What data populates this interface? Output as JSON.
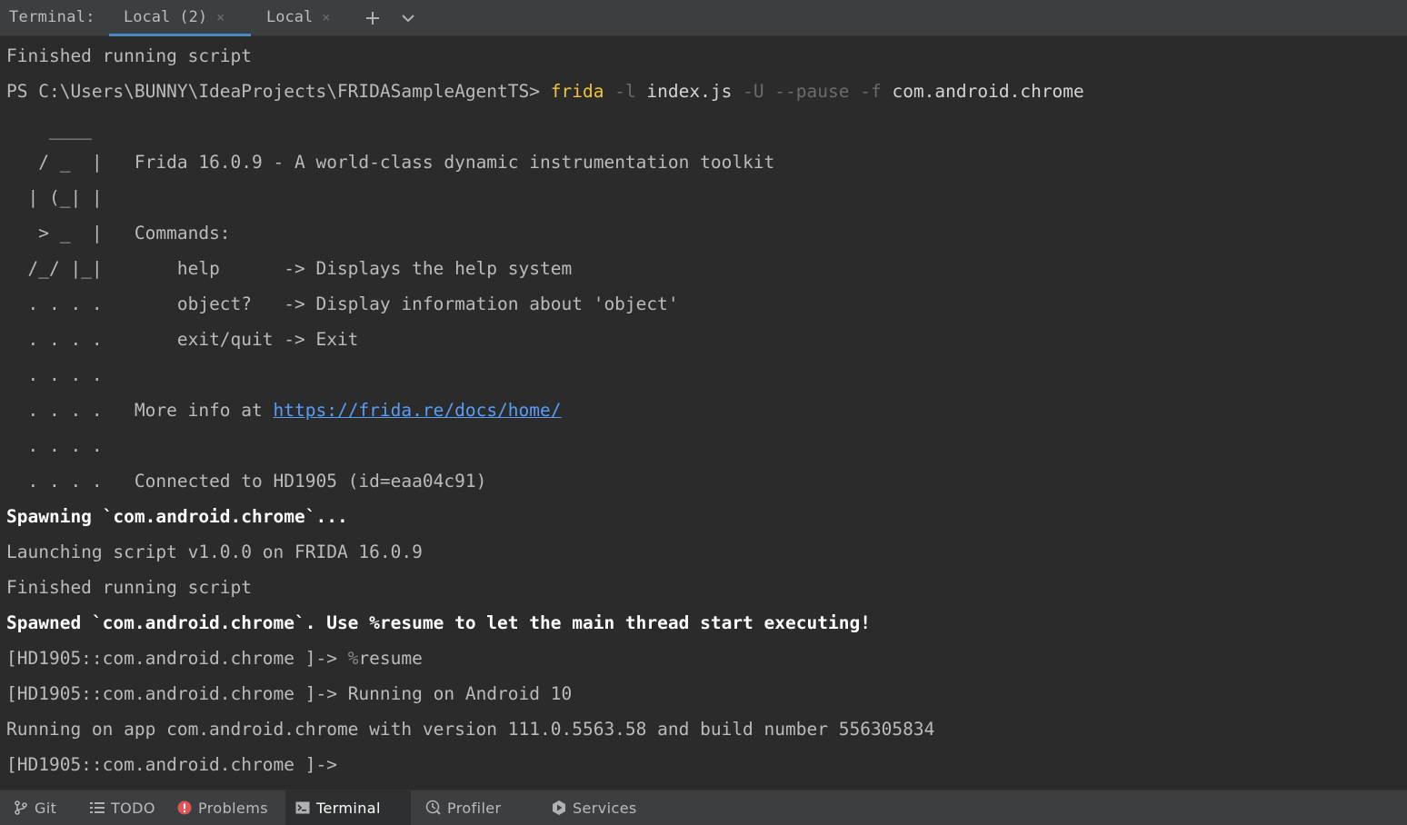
{
  "tabbar": {
    "title": "Terminal:",
    "tabs": [
      {
        "label": "Local (2)",
        "active": true
      },
      {
        "label": "Local",
        "active": false
      }
    ],
    "close_glyph": "×",
    "add_icon": "plus-icon",
    "more_icon": "chevron-down-icon"
  },
  "terminal": {
    "l01": "Finished running script",
    "l02": {
      "prompt": "PS C:\\Users\\BUNNY\\IdeaProjects\\FRIDASampleAgentTS> ",
      "cmd": "frida",
      "opt1": " -l ",
      "arg1": "index.js",
      "opt2": " -U --pause -f ",
      "arg2": "com.android.chrome"
    },
    "l03": "    ____",
    "l04": {
      "art": "   / _  |   ",
      "text": "Frida 16.0.9 - A world-class dynamic instrumentation toolkit"
    },
    "l05": {
      "art": "  | (_| |",
      "text": ""
    },
    "l06": {
      "art": "   > _  |   ",
      "text": "Commands:"
    },
    "l07": {
      "art": "  /_/ |_|       ",
      "text": "help      -> Displays the help system"
    },
    "l08": {
      "art": "  . . . .       ",
      "text": "object?   -> Display information about 'object'"
    },
    "l09": {
      "art": "  . . . .       ",
      "text": "exit/quit -> Exit"
    },
    "l10": {
      "art": "  . . . .",
      "text": ""
    },
    "l11": {
      "art": "  . . . .   ",
      "text": "More info at ",
      "link": "https://frida.re/docs/home/"
    },
    "l12": {
      "art": "  . . . .",
      "text": ""
    },
    "l13": {
      "art": "  . . . .   ",
      "text": "Connected to HD1905 (id=eaa04c91)"
    },
    "l14": "Spawning `com.android.chrome`...",
    "l15": "Launching script v1.0.0 on FRIDA 16.0.9",
    "l16": "Finished running script",
    "l17": "Spawned `com.android.chrome`. Use %resume to let the main thread start executing!",
    "l18": {
      "prompt": "[HD1905::com.android.chrome ]-> ",
      "pct": "%",
      "text": "resume"
    },
    "l19": {
      "prompt": "[HD1905::com.android.chrome ]-> ",
      "text": "Running on Android 10"
    },
    "l20": "Running on app com.android.chrome with version 111.0.5563.58 and build number 556305834",
    "l21": "[HD1905::com.android.chrome ]->"
  },
  "bottombar": {
    "items": [
      {
        "label": "Git",
        "icon": "git-branch-icon"
      },
      {
        "label": "TODO",
        "icon": "list-icon"
      },
      {
        "label": "Problems",
        "icon": "error-icon"
      },
      {
        "label": "Terminal",
        "icon": "terminal-icon",
        "active": true
      },
      {
        "label": "Profiler",
        "icon": "profiler-icon"
      },
      {
        "label": "Services",
        "icon": "services-icon"
      }
    ]
  },
  "colors": {
    "background": "#2b2b2b",
    "toolbar": "#3c3f41",
    "accent": "#4a88c7",
    "command": "#f0c33c",
    "link": "#589df6",
    "error": "#e05555"
  }
}
